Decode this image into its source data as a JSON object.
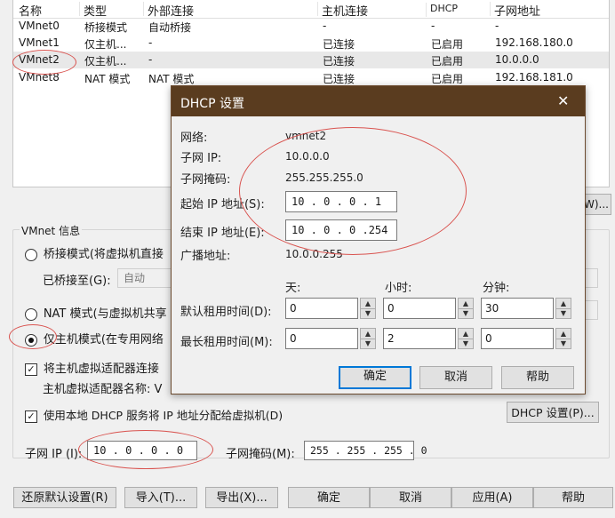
{
  "table": {
    "headers": [
      "名称",
      "类型",
      "外部连接",
      "主机连接",
      "DHCP",
      "子网地址"
    ],
    "rows": [
      [
        "VMnet0",
        "桥接模式",
        "自动桥接",
        "-",
        "-",
        "-"
      ],
      [
        "VMnet1",
        "仅主机...",
        "-",
        "已连接",
        "已启用",
        "192.168.180.0"
      ],
      [
        "VMnet2",
        "仅主机...",
        "-",
        "已连接",
        "已启用",
        "10.0.0.0"
      ],
      [
        "VMnet8",
        "NAT 模式",
        "NAT 模式",
        "已连接",
        "已启用",
        "192.168.181.0"
      ]
    ],
    "selected_row": 2
  },
  "partial_button": "W)...",
  "vmnet_info": {
    "title": "VMnet 信息",
    "bridged_radio": "桥接模式(将虚拟机直接",
    "bridged_to_label": "已桥接至(G):",
    "bridged_to_value": "自动",
    "nat_radio": "NAT 模式(与虚拟机共享",
    "hostonly_radio": "仅主机模式(在专用网络",
    "connect_adapter_check": "将主机虚拟适配器连接",
    "adapter_name_label": "主机虚拟适配器名称: V",
    "dhcp_check": "使用本地 DHCP 服务将 IP 地址分配给虚拟机(D)",
    "dhcp_settings_button": "DHCP 设置(P)...",
    "subnet_ip_label": "子网 IP (I):",
    "subnet_ip_value": "10 . 0 . 0 . 0",
    "subnet_mask_label": "子网掩码(M):",
    "subnet_mask_value": "255 . 255 . 255 . 0"
  },
  "bottom_buttons": {
    "restore": "还原默认设置(R)",
    "import": "导入(T)...",
    "export": "导出(X)...",
    "ok": "确定",
    "cancel": "取消",
    "apply": "应用(A)",
    "help": "帮助"
  },
  "dialog": {
    "title": "DHCP 设置",
    "close_glyph": "✕",
    "network_label": "网络:",
    "network_value": "vmnet2",
    "subnet_ip_label": "子网 IP:",
    "subnet_ip_value": "10.0.0.0",
    "subnet_mask_label": "子网掩码:",
    "subnet_mask_value": "255.255.255.0",
    "start_ip_label": "起始 IP 地址(S):",
    "start_ip_value": "10 . 0 . 0 . 1",
    "end_ip_label": "结束 IP 地址(E):",
    "end_ip_value": "10 . 0 . 0 .254",
    "broadcast_label": "广播地址:",
    "broadcast_value": "10.0.0.255",
    "col_day": "天:",
    "col_hour": "小时:",
    "col_minute": "分钟:",
    "default_lease_label": "默认租用时间(D):",
    "default_lease": {
      "day": "0",
      "hour": "0",
      "minute": "30"
    },
    "max_lease_label": "最长租用时间(M):",
    "max_lease": {
      "day": "0",
      "hour": "2",
      "minute": "0"
    },
    "ok": "确定",
    "cancel": "取消",
    "help": "帮助"
  },
  "colors": {
    "dialog_title_bg": "#5a3c1f",
    "annotation_red": "#d9534f",
    "focus_blue": "#0078d7"
  }
}
